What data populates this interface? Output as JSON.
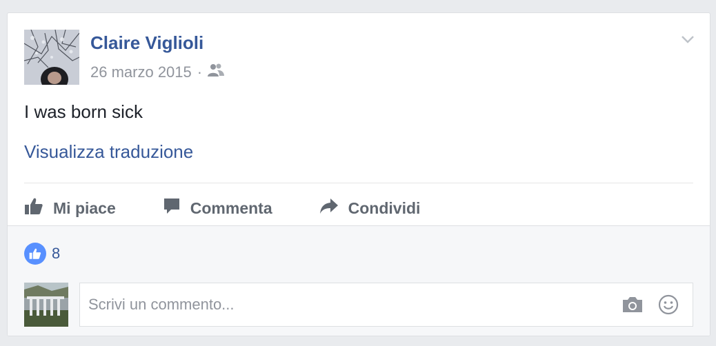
{
  "post": {
    "author": "Claire Viglioli",
    "date": "26 marzo 2015",
    "separator": "·",
    "privacy_icon": "friends-icon",
    "text": "I was born sick",
    "translate_link": "Visualizza traduzione"
  },
  "actions": {
    "like_label": "Mi piace",
    "comment_label": "Commenta",
    "share_label": "Condividi"
  },
  "reactions": {
    "like_count": "8"
  },
  "comment": {
    "placeholder": "Scrivi un commento..."
  },
  "colors": {
    "link": "#365899",
    "like_badge": "#5890ff",
    "muted": "#90949c"
  }
}
